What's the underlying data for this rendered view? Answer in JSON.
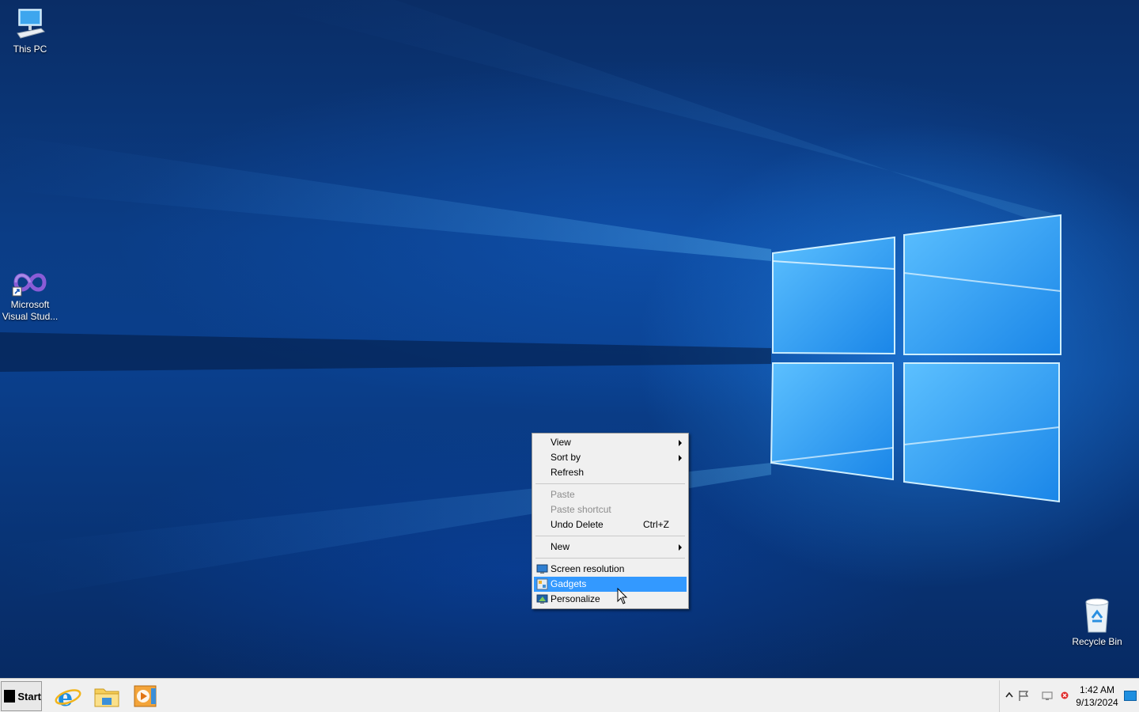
{
  "desktop": {
    "icons": [
      {
        "label": "This PC",
        "icon": "this-pc-icon"
      },
      {
        "label": "Microsoft Visual Stud...",
        "icon": "visual-studio-icon"
      },
      {
        "label": "Recycle Bin",
        "icon": "recycle-bin-icon"
      }
    ]
  },
  "context_menu": {
    "items": [
      {
        "label": "View",
        "submenu": true,
        "enabled": true
      },
      {
        "label": "Sort by",
        "submenu": true,
        "enabled": true
      },
      {
        "label": "Refresh",
        "enabled": true
      },
      {
        "label": "Paste",
        "enabled": false
      },
      {
        "label": "Paste shortcut",
        "enabled": false
      },
      {
        "label": "Undo Delete",
        "shortcut": "Ctrl+Z",
        "enabled": true
      },
      {
        "label": "New",
        "submenu": true,
        "enabled": true
      },
      {
        "label": "Screen resolution",
        "icon": "screen-resolution-icon",
        "enabled": true
      },
      {
        "label": "Gadgets",
        "icon": "gadgets-icon",
        "enabled": true,
        "highlighted": true
      },
      {
        "label": "Personalize",
        "icon": "personalize-icon",
        "enabled": true
      }
    ]
  },
  "taskbar": {
    "start_label": "Start",
    "pinned": [
      {
        "name": "Internet Explorer",
        "icon": "internet-explorer-icon"
      },
      {
        "name": "File Explorer",
        "icon": "file-explorer-icon"
      },
      {
        "name": "Windows Media Player",
        "icon": "media-player-icon"
      }
    ],
    "tray": {
      "time": "1:42 AM",
      "date": "9/13/2024"
    }
  },
  "colors": {
    "menu_highlight": "#3399ff",
    "menu_background": "#f0f0f0",
    "taskbar_background": "#f0f0f0",
    "wallpaper_blue": "#0b3d86"
  }
}
